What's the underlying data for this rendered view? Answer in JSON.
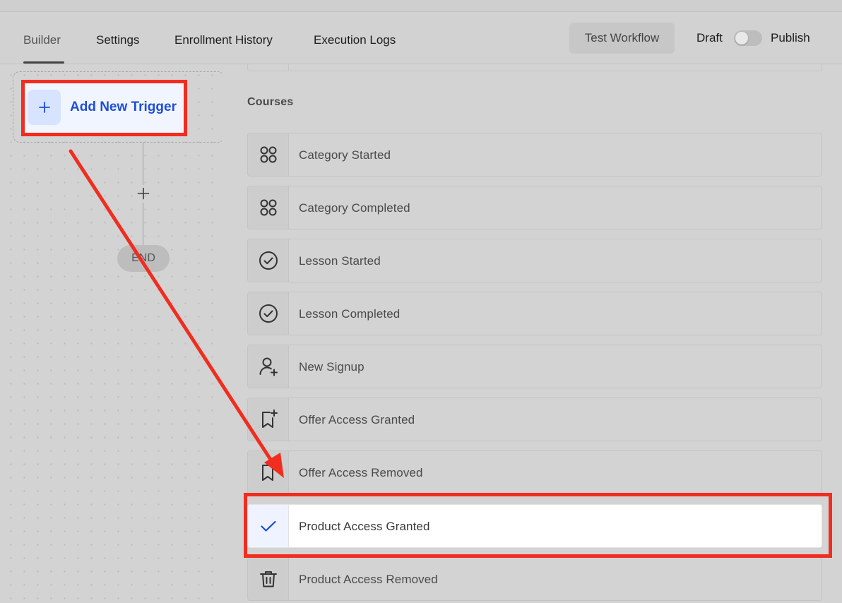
{
  "tabs": [
    {
      "label": "Builder",
      "active": true
    },
    {
      "label": "Settings",
      "active": false
    },
    {
      "label": "Enrollment History",
      "active": false
    },
    {
      "label": "Execution Logs",
      "active": false
    }
  ],
  "header": {
    "test_button": "Test Workflow",
    "toggle": {
      "off_label": "Draft",
      "on_label": "Publish",
      "is_on": false
    }
  },
  "builder": {
    "trigger_label": "Add New Trigger",
    "end_label": "END"
  },
  "panel": {
    "section_title": "Courses",
    "items": [
      {
        "label": "Category Started",
        "icon": "grid-icon",
        "selected": false
      },
      {
        "label": "Category Completed",
        "icon": "grid-icon",
        "selected": false
      },
      {
        "label": "Lesson Started",
        "icon": "check-circle-icon",
        "selected": false
      },
      {
        "label": "Lesson Completed",
        "icon": "check-circle-icon",
        "selected": false
      },
      {
        "label": "New Signup",
        "icon": "user-plus-icon",
        "selected": false
      },
      {
        "label": "Offer Access Granted",
        "icon": "bookmark-plus-icon",
        "selected": false
      },
      {
        "label": "Offer Access Removed",
        "icon": "bookmark-icon",
        "selected": false
      },
      {
        "label": "Product Access Granted",
        "icon": "checkmark-icon",
        "selected": true
      },
      {
        "label": "Product Access Removed",
        "icon": "trash-icon",
        "selected": false
      }
    ]
  },
  "colors": {
    "accent_blue": "#1d4ed8",
    "annotation_red": "#f02d1f",
    "overlay_gray": "#d3d3d3"
  }
}
